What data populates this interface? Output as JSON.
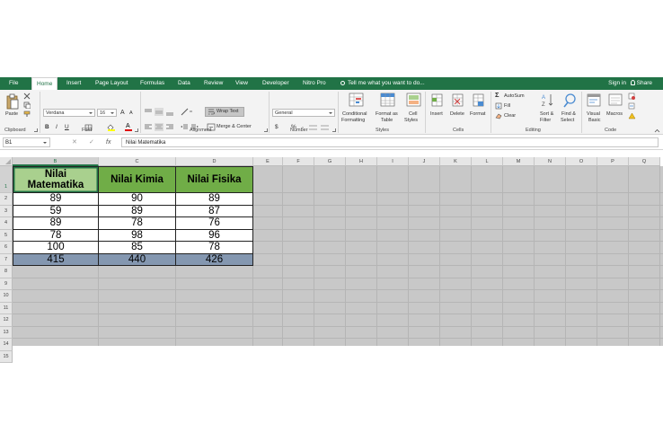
{
  "tabs": [
    "File",
    "Home",
    "Insert",
    "Page Layout",
    "Formulas",
    "Data",
    "Review",
    "View",
    "Developer",
    "Nitro Pro"
  ],
  "tell_me": "Tell me what you want to do...",
  "sign_in": "Sign in",
  "share": "Share",
  "ribbon": {
    "clipboard": {
      "label": "Clipboard",
      "paste": "Paste"
    },
    "font": {
      "label": "Font",
      "name": "Verdana",
      "size": "16",
      "bold": "B",
      "italic": "I",
      "underline": "U",
      "grow": "A",
      "shrink": "A",
      "font_color": "A"
    },
    "alignment": {
      "label": "Alignment",
      "wrap": "Wrap Text",
      "merge": "Merge & Center"
    },
    "number": {
      "label": "Number",
      "format": "General",
      "currency": "$",
      "percent": "%",
      "comma": ","
    },
    "styles": {
      "label": "Styles",
      "cond_l1": "Conditional",
      "cond_l2": "Formatting",
      "table_l1": "Format as",
      "table_l2": "Table",
      "cell_l1": "Cell",
      "cell_l2": "Styles"
    },
    "cells": {
      "label": "Cells",
      "insert": "Insert",
      "delete": "Delete",
      "format": "Format"
    },
    "editing": {
      "label": "Editing",
      "autosum": "AutoSum",
      "fill": "Fill",
      "clear": "Clear",
      "sort_l1": "Sort &",
      "sort_l2": "Filter",
      "find_l1": "Find &",
      "find_l2": "Select"
    },
    "code": {
      "label": "Code",
      "vb_l1": "Visual",
      "vb_l2": "Basic",
      "macros": "Macros"
    }
  },
  "formula_bar": {
    "name_box": "B1",
    "cancel": "✕",
    "enter": "✓",
    "fx": "fx",
    "content": "Nilai Matematika"
  },
  "columns": [
    "B",
    "C",
    "D",
    "E",
    "F",
    "G",
    "H",
    "I",
    "J",
    "K",
    "L",
    "M",
    "N",
    "O",
    "P",
    "Q"
  ],
  "rows": [
    "1",
    "2",
    "3",
    "4",
    "5",
    "6",
    "7",
    "8",
    "9",
    "10",
    "11",
    "12",
    "13",
    "14",
    "15"
  ],
  "table": {
    "headers": [
      [
        "Nilai",
        "Matematika"
      ],
      [
        "Nilai Kimia"
      ],
      [
        "Nilai Fisika"
      ]
    ],
    "data": [
      [
        "89",
        "90",
        "89"
      ],
      [
        "59",
        "89",
        "87"
      ],
      [
        "89",
        "78",
        "76"
      ],
      [
        "78",
        "98",
        "96"
      ],
      [
        "100",
        "85",
        "78"
      ]
    ],
    "totals": [
      "415",
      "440",
      "426"
    ]
  },
  "colors": {
    "excel_green": "#217346",
    "header_green_light": "#a9d08e",
    "header_green": "#70ad47",
    "total_blue": "#8497b0"
  }
}
